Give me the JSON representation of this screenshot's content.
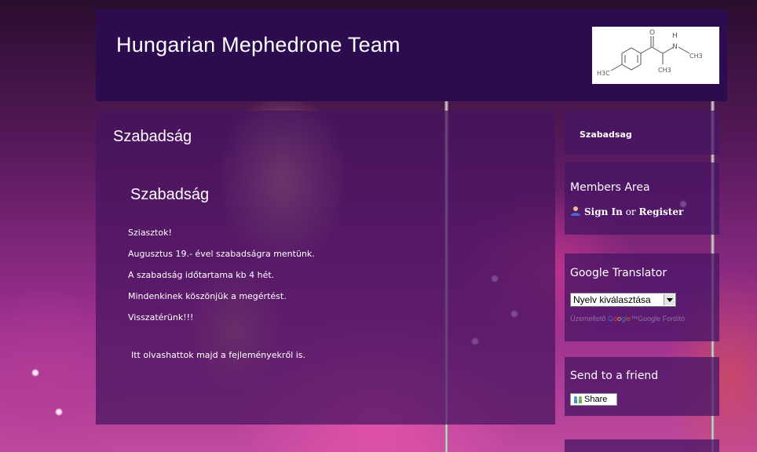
{
  "header": {
    "site_title": "Hungarian Mephedrone Team"
  },
  "main": {
    "page_heading": "Szabadság",
    "post_title": "Szabadság",
    "post_lines": [
      "Sziasztok!",
      "Augusztus 19.- ével szabadságra mentünk.",
      "A szabadság időtartama kb  4 hét.",
      "Mindenkinek köszönjük a megértést.",
      "Visszatérünk!!!"
    ],
    "post_footer": "Itt olvashattok majd a fejleményekről is."
  },
  "sidebar": {
    "szabadsag_link": "Szabadsag",
    "members": {
      "title": "Members Area",
      "sign_in": "Sign In",
      "or": "or",
      "register": "Register"
    },
    "translator": {
      "title": "Google Translator",
      "selected_language": "Nyelv kiválasztása",
      "powered_prefix": "Üzemeltető",
      "powered_suffix": "Google Fordító"
    },
    "send": {
      "title": "Send to a friend",
      "share_label": "Share"
    }
  },
  "logo_text": {
    "h3c": "H3C",
    "ch3_top": "CH3",
    "ch3_bottom": "CH3",
    "o": "O",
    "h": "H",
    "n": "N"
  },
  "colors": {
    "header_bg": "#2c0b4f",
    "panel_bg": "#46145f",
    "text": "#ffffff"
  },
  "icons": [
    "user-icon",
    "share-icon",
    "select-arrow-icon"
  ]
}
